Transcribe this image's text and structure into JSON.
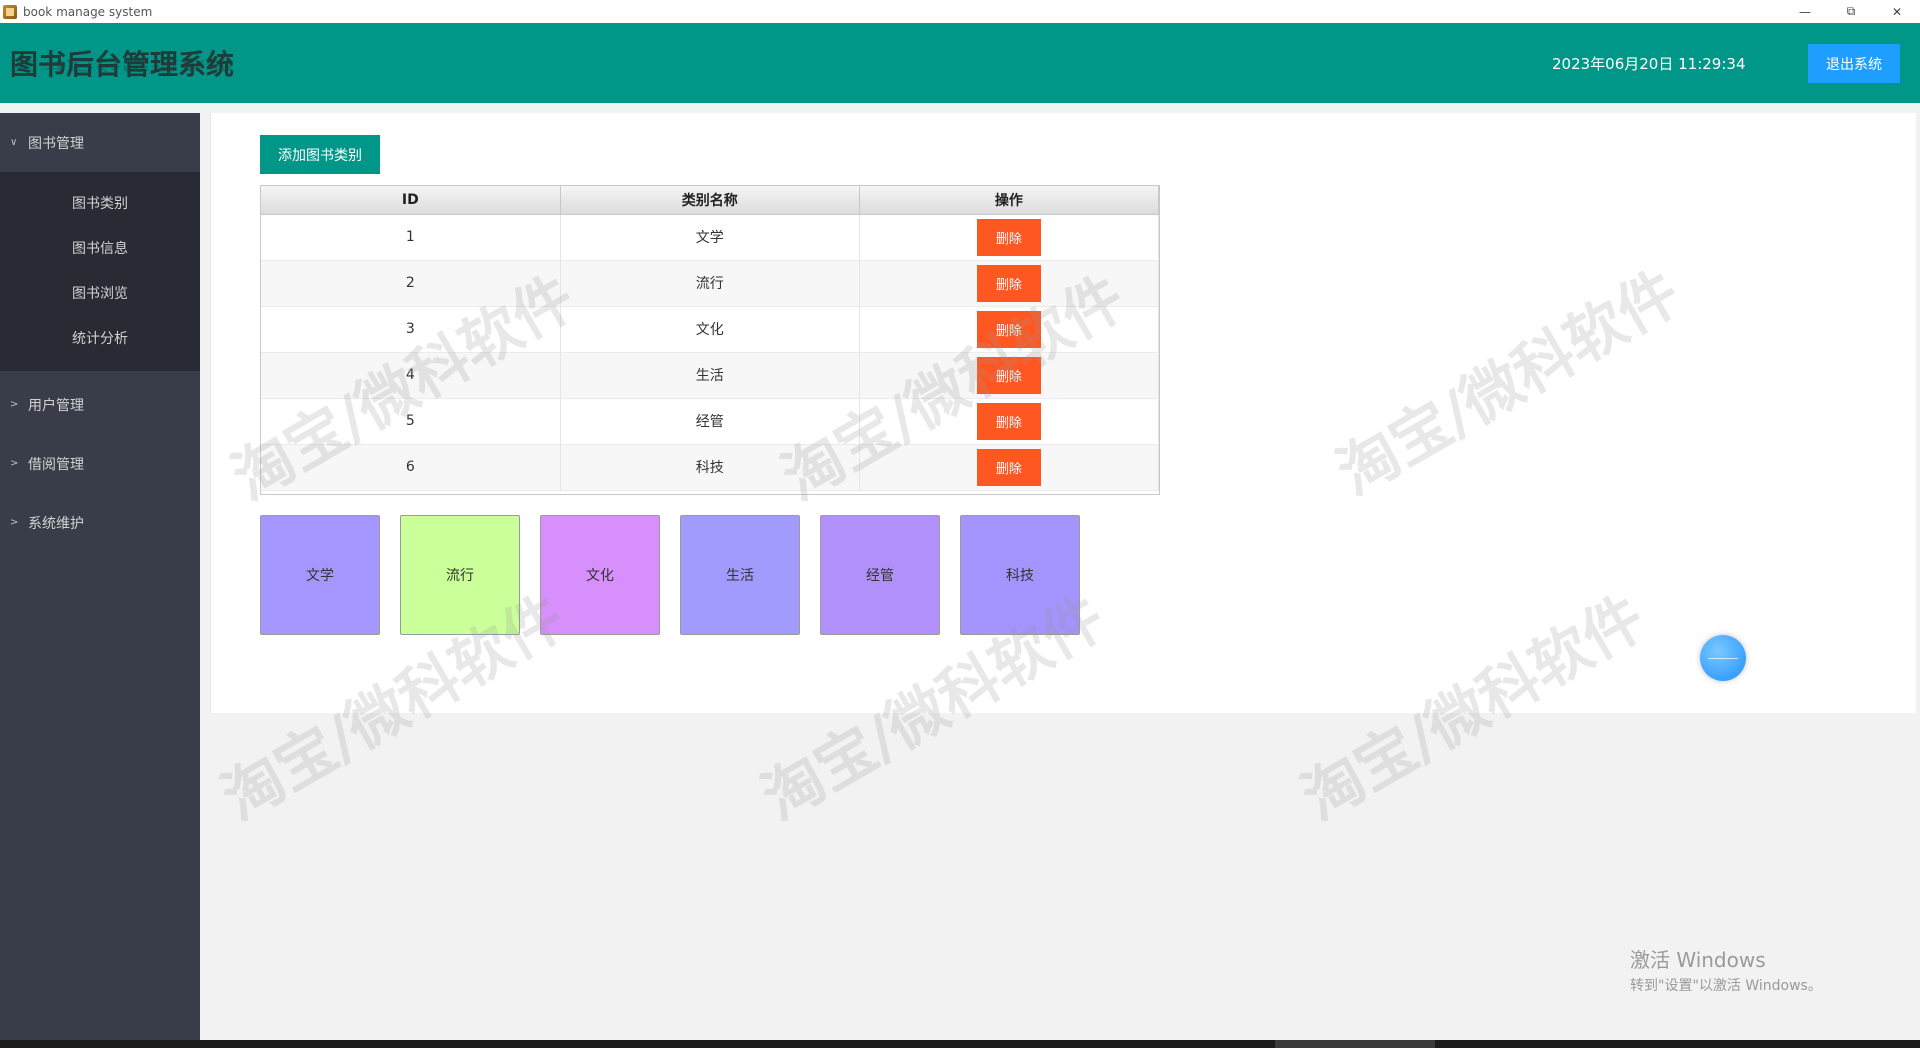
{
  "window": {
    "title": "book manage system",
    "controls": [
      "minimize-icon",
      "restore-icon",
      "close-icon"
    ]
  },
  "header": {
    "system_title": "图书后台管理系统",
    "datetime": "2023年06月20日 11:29:34",
    "logout_label": "退出系统",
    "accent_color": "#009688"
  },
  "sidebar": {
    "groups": [
      {
        "label": "图书管理",
        "expanded": true,
        "items": [
          "图书类别",
          "图书信息",
          "图书浏览",
          "统计分析"
        ]
      },
      {
        "label": "用户管理",
        "expanded": false
      },
      {
        "label": "借阅管理",
        "expanded": false
      },
      {
        "label": "系统维护",
        "expanded": false
      }
    ]
  },
  "main": {
    "add_button_label": "添加图书类别",
    "table": {
      "columns": [
        "ID",
        "类别名称",
        "操作"
      ],
      "rows": [
        {
          "id": "1",
          "name": "文学",
          "action": "删除"
        },
        {
          "id": "2",
          "name": "流行",
          "action": "删除"
        },
        {
          "id": "3",
          "name": "文化",
          "action": "删除"
        },
        {
          "id": "4",
          "name": "生活",
          "action": "删除"
        },
        {
          "id": "5",
          "name": "经管",
          "action": "删除"
        },
        {
          "id": "6",
          "name": "科技",
          "action": "删除"
        }
      ]
    },
    "category_cards": [
      {
        "label": "文学",
        "color": "#a397ff"
      },
      {
        "label": "流行",
        "color": "#cbff99"
      },
      {
        "label": "文化",
        "color": "#d68ffb"
      },
      {
        "label": "生活",
        "color": "#a29bfe"
      },
      {
        "label": "经管",
        "color": "#b190fb"
      },
      {
        "label": "科技",
        "color": "#a494fd"
      }
    ]
  },
  "watermark_text": "淘宝/微科软件",
  "os_overlay": {
    "activation_title": "激活 Windows",
    "activation_sub": "转到\"设置\"以激活 Windows。"
  }
}
